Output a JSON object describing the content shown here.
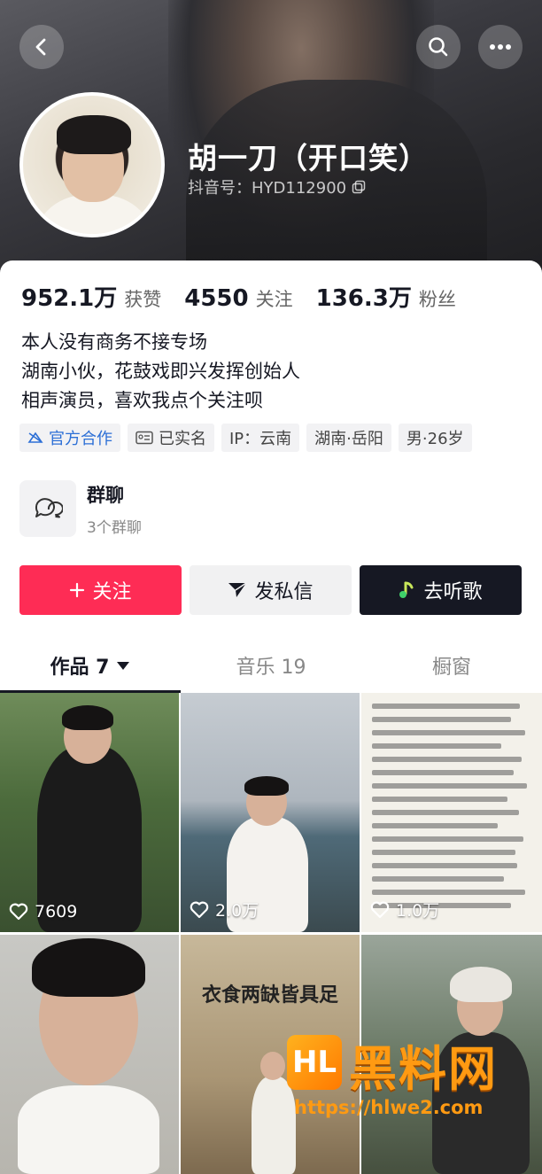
{
  "profile": {
    "name": "胡一刀（开口笑）",
    "douyin_id": "抖音号：HYD112900"
  },
  "stats": [
    {
      "num": "952.1万",
      "label": "获赞"
    },
    {
      "num": "4550",
      "label": "关注"
    },
    {
      "num": "136.3万",
      "label": "粉丝"
    }
  ],
  "bio": [
    "本人没有商务不接专场",
    "湖南小伙，花鼓戏即兴发挥创始人",
    "相声演员，喜欢我点个关注呗"
  ],
  "tags": [
    {
      "label": "官方合作",
      "icon": "official-icon"
    },
    {
      "label": "已实名",
      "icon": "id-card-icon"
    },
    {
      "label": "IP：云南"
    },
    {
      "label": "湖南·岳阳"
    },
    {
      "label": "男·26岁"
    }
  ],
  "group": {
    "title": "群聊",
    "subtitle": "3个群聊"
  },
  "actions": {
    "follow": "关注",
    "dm": "发私信",
    "music": "去听歌"
  },
  "tabs": [
    {
      "label": "作品 7",
      "active": true
    },
    {
      "label": "音乐 19"
    },
    {
      "label": "橱窗"
    }
  ],
  "videos": [
    {
      "likes": "7609"
    },
    {
      "likes": "2.0万"
    },
    {
      "likes": "1.0万"
    },
    {
      "likes": ""
    },
    {
      "likes": "",
      "overlay": "衣食两缺皆具足"
    },
    {
      "likes": ""
    }
  ],
  "watermark": {
    "title": "黑料网",
    "url": "https://hlwe2.com",
    "logo": "HL"
  },
  "colors": {
    "follow": "#fe2c55",
    "dark": "#161823",
    "official": "#2c6fd6",
    "watermark": "#ff9a12"
  }
}
